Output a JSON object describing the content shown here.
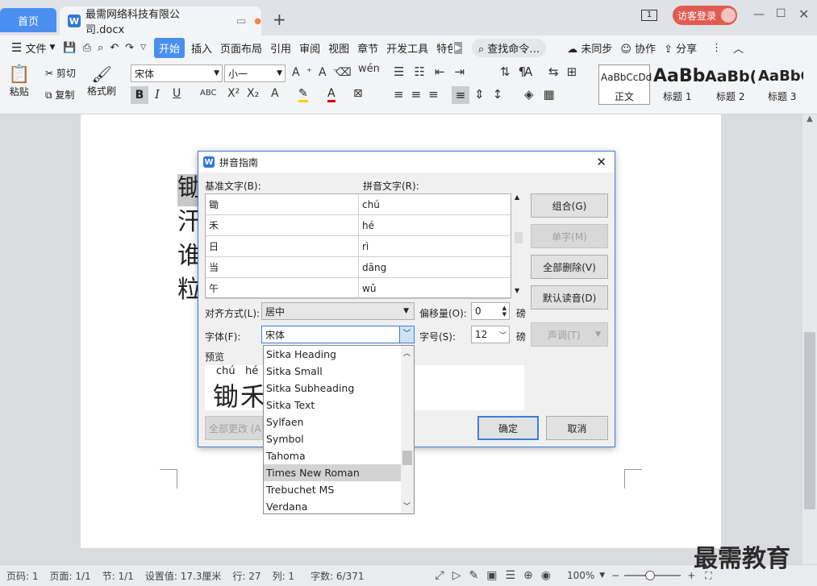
{
  "tabs": {
    "home": "首页",
    "doc": "最需网络科技有限公司.docx",
    "add": "+"
  },
  "window": {
    "badge": "1",
    "login": "访客登录"
  },
  "menu": [
    "文件",
    "开始",
    "插入",
    "页面布局",
    "引用",
    "审阅",
    "视图",
    "章节",
    "开发工具",
    "特色"
  ],
  "menu_right": {
    "search": "查找命令…",
    "sync": "未同步",
    "collab": "协作",
    "share": "分享"
  },
  "ribbon": {
    "paste": "粘贴",
    "cut": "剪切",
    "copy": "复制",
    "format_painter": "格式刷",
    "font": "宋体",
    "size": "小一",
    "styles": [
      {
        "sample": "AaBbCcDd",
        "name": "正文"
      },
      {
        "sample": "AaBb",
        "name": "标题 1"
      },
      {
        "sample": "AaBb(",
        "name": "标题 2"
      },
      {
        "sample": "AaBbC",
        "name": "标题 3"
      }
    ]
  },
  "doc_chars": [
    "锄",
    "汗",
    "谁",
    "粒"
  ],
  "dialog": {
    "title": "拼音指南",
    "base_label": "基准文字(B):",
    "pinyin_label": "拼音文字(R):",
    "rows": [
      {
        "base": "锄",
        "pinyin": "chú"
      },
      {
        "base": "禾",
        "pinyin": "hé"
      },
      {
        "base": "日",
        "pinyin": "rì"
      },
      {
        "base": "当",
        "pinyin": "dāng"
      },
      {
        "base": "午",
        "pinyin": "wǔ"
      }
    ],
    "combine": "组合(G)",
    "single": "单字(M)",
    "clear_all": "全部删除(V)",
    "default_reading": "默认读音(D)",
    "tone": "声调(T)",
    "align_label": "对齐方式(L):",
    "align_value": "居中",
    "offset_label": "偏移量(O):",
    "offset_value": "0",
    "unit1": "磅",
    "font_label": "字体(F):",
    "font_value": "宋体",
    "size_label": "字号(S):",
    "size_value": "12",
    "unit2": "磅",
    "preview_label": "预览",
    "preview_pinyin": [
      "chú",
      "hé"
    ],
    "preview_chars": "锄禾",
    "change_all": "全部更改 (A)",
    "ok": "确定",
    "cancel": "取消",
    "font_options": [
      "Sitka Heading",
      "Sitka Small",
      "Sitka Subheading",
      "Sitka Text",
      "Sylfaen",
      "Symbol",
      "Tahoma",
      "Times New Roman",
      "Trebuchet MS",
      "Verdana"
    ],
    "font_selected": "Times New Roman"
  },
  "status": {
    "page": "页码: 1",
    "pages": "页面: 1/1",
    "section": "节: 1/1",
    "setting": "设置值: 17.3厘米",
    "row": "行: 27",
    "col": "列: 1",
    "words": "字数: 6/371",
    "zoom": "100%"
  },
  "watermark": "最需教育"
}
